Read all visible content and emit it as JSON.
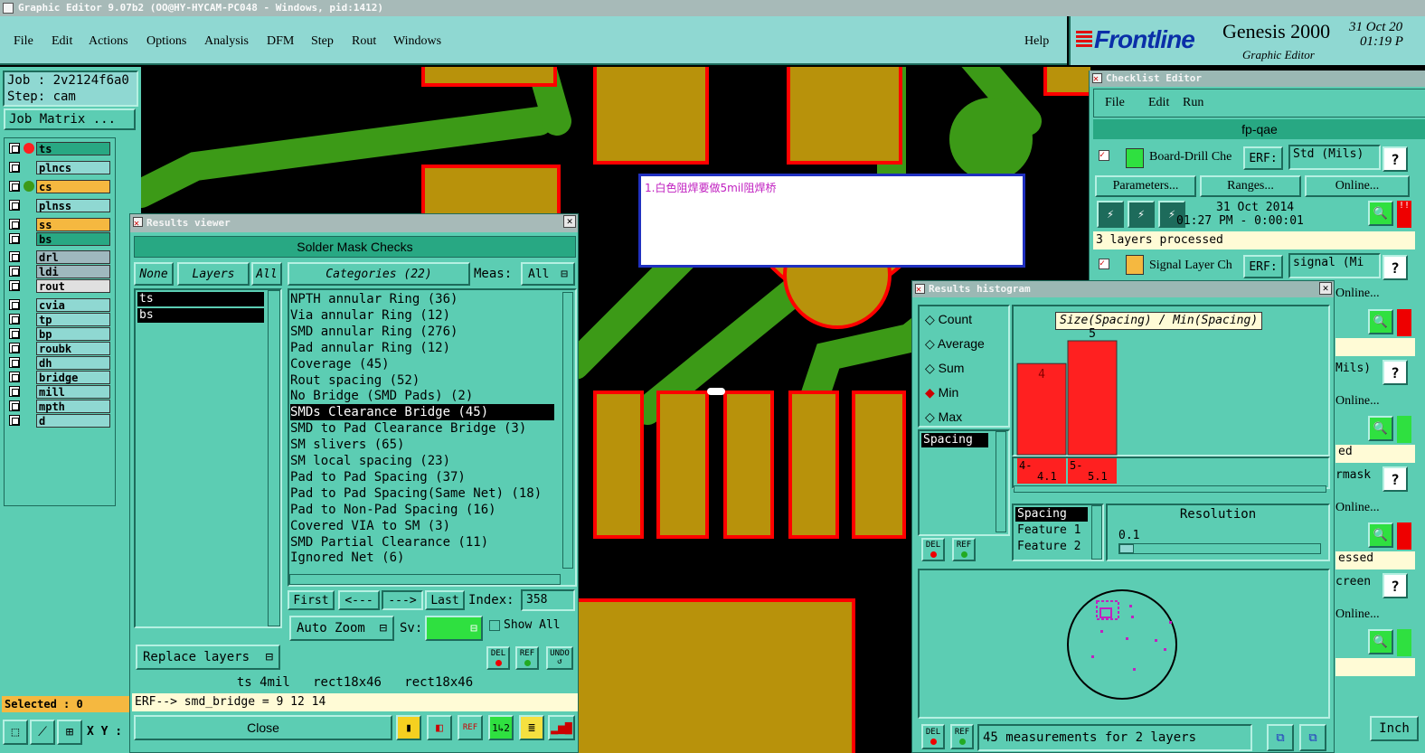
{
  "window_title": "Graphic Editor 9.07b2 (OO@HY-HYCAM-PC048 - Windows, pid:1412)",
  "menu": [
    "File",
    "Edit",
    "Actions",
    "Options",
    "Analysis",
    "DFM",
    "Step",
    "Rout",
    "Windows"
  ],
  "help_label": "Help",
  "brand": {
    "name": "Frontline",
    "product": "Genesis 2000",
    "subtitle": "Graphic Editor",
    "date": "31 Oct 20",
    "time": "01:19 P"
  },
  "job": {
    "label": "Job : 2v2124f6a0",
    "step": "Step: cam",
    "matrix_button": "Job Matrix ..."
  },
  "layers": [
    "ts",
    "plncs",
    "cs",
    "plnss",
    "ss",
    "bs",
    "drl",
    "ldi",
    "rout",
    "cvia",
    "tp",
    "bp",
    "roubk",
    "dh",
    "bridge",
    "mill",
    "mpth",
    "d"
  ],
  "selected_label": "Selected : 0",
  "xy_label": "X Y :",
  "annotation_text": "1.白色阻焊要做5mil阻焊桥",
  "results_viewer": {
    "title": "Results viewer",
    "header": "Solder Mask Checks",
    "none_btn": "None",
    "layers_btn": "Layers",
    "all_btn": "All",
    "categories_btn": "Categories (22)",
    "meas_label": "Meas:",
    "meas_value": "All",
    "layer_list": [
      "ts",
      "bs"
    ],
    "categories": [
      "NPTH annular Ring (36)",
      "Via annular Ring (12)",
      "SMD annular Ring (276)",
      "Pad annular Ring (12)",
      "Coverage (45)",
      "Rout spacing (52)",
      "No Bridge (SMD Pads) (2)",
      "SMDs Clearance Bridge (45)",
      "SMD to Pad Clearance Bridge (3)",
      "SM slivers (65)",
      "SM local spacing (23)",
      "Pad to Pad Spacing (37)",
      "Pad to Pad Spacing(Same Net) (18)",
      "Pad to Non-Pad Spacing (16)",
      "Covered VIA to SM (3)",
      "SMD Partial Clearance (11)",
      "Ignored Net (6)"
    ],
    "selected_index": 7,
    "first": "First",
    "prev": "<---",
    "next": "--->",
    "last": "Last",
    "index_label": "Index:",
    "index_value": "358",
    "auto_zoom": "Auto Zoom",
    "sv_label": "Sv:",
    "show_all": "Show All",
    "replace_layers": "Replace layers",
    "del": "DEL",
    "ref": "REF",
    "undo": "UNDO",
    "status_line": "ts 4mil   rect18x46   rect18x46",
    "erf_line": "ERF--> smd_bridge = 9 12 14",
    "close": "Close"
  },
  "checklist": {
    "title": "Checklist Editor",
    "menu": [
      "File",
      "Edit",
      "Run"
    ],
    "name": "fp-qae",
    "item1": {
      "label": "Board-Drill Che",
      "erf": "ERF:",
      "erf_value": "Std (Mils)",
      "q": "?"
    },
    "parameters": "Parameters...",
    "ranges": "Ranges...",
    "online": "Online...",
    "date": "31 Oct 2014",
    "time": "01:27 PM - 0:00:01",
    "processed": "3 layers processed",
    "item2": {
      "label": "Signal Layer Ch",
      "erf": "ERF:",
      "erf_value": "signal (Mi",
      "q": "?"
    },
    "fragments": [
      "Online...",
      "Mils)",
      "Online...",
      "ed",
      "rmask",
      "Online...",
      "essed",
      "creen",
      "Online..."
    ]
  },
  "histogram": {
    "title": "Results histogram",
    "options": [
      "Count",
      "Average",
      "Sum",
      "Min",
      "Max"
    ],
    "selected_option": "Min",
    "chart_title": "Size(Spacing) / Min(Spacing)",
    "list_item": "Spacing",
    "feature_list": [
      "Spacing",
      "Feature 1",
      "Feature 2"
    ],
    "resolution_label": "Resolution",
    "resolution_value": "0.1",
    "bin_labels": [
      [
        "4-",
        "4.1"
      ],
      [
        "5-",
        "5.1"
      ]
    ],
    "del": "DEL",
    "ref": "REF",
    "measurements": "45 measurements for 2 layers"
  },
  "chart_data": {
    "type": "bar",
    "title": "Size(Spacing) / Min(Spacing)",
    "categories": [
      "4-4.1",
      "5-5.1"
    ],
    "values": [
      4,
      5
    ],
    "color": "#ff2020"
  },
  "inch_label": "Inch",
  "colors": {
    "panel": "#5ccdb3",
    "board": "#000000",
    "copper": "#b8920b",
    "track": "#3c9a17",
    "mask_edge": "#ff0000",
    "accent": "#ff2020"
  }
}
